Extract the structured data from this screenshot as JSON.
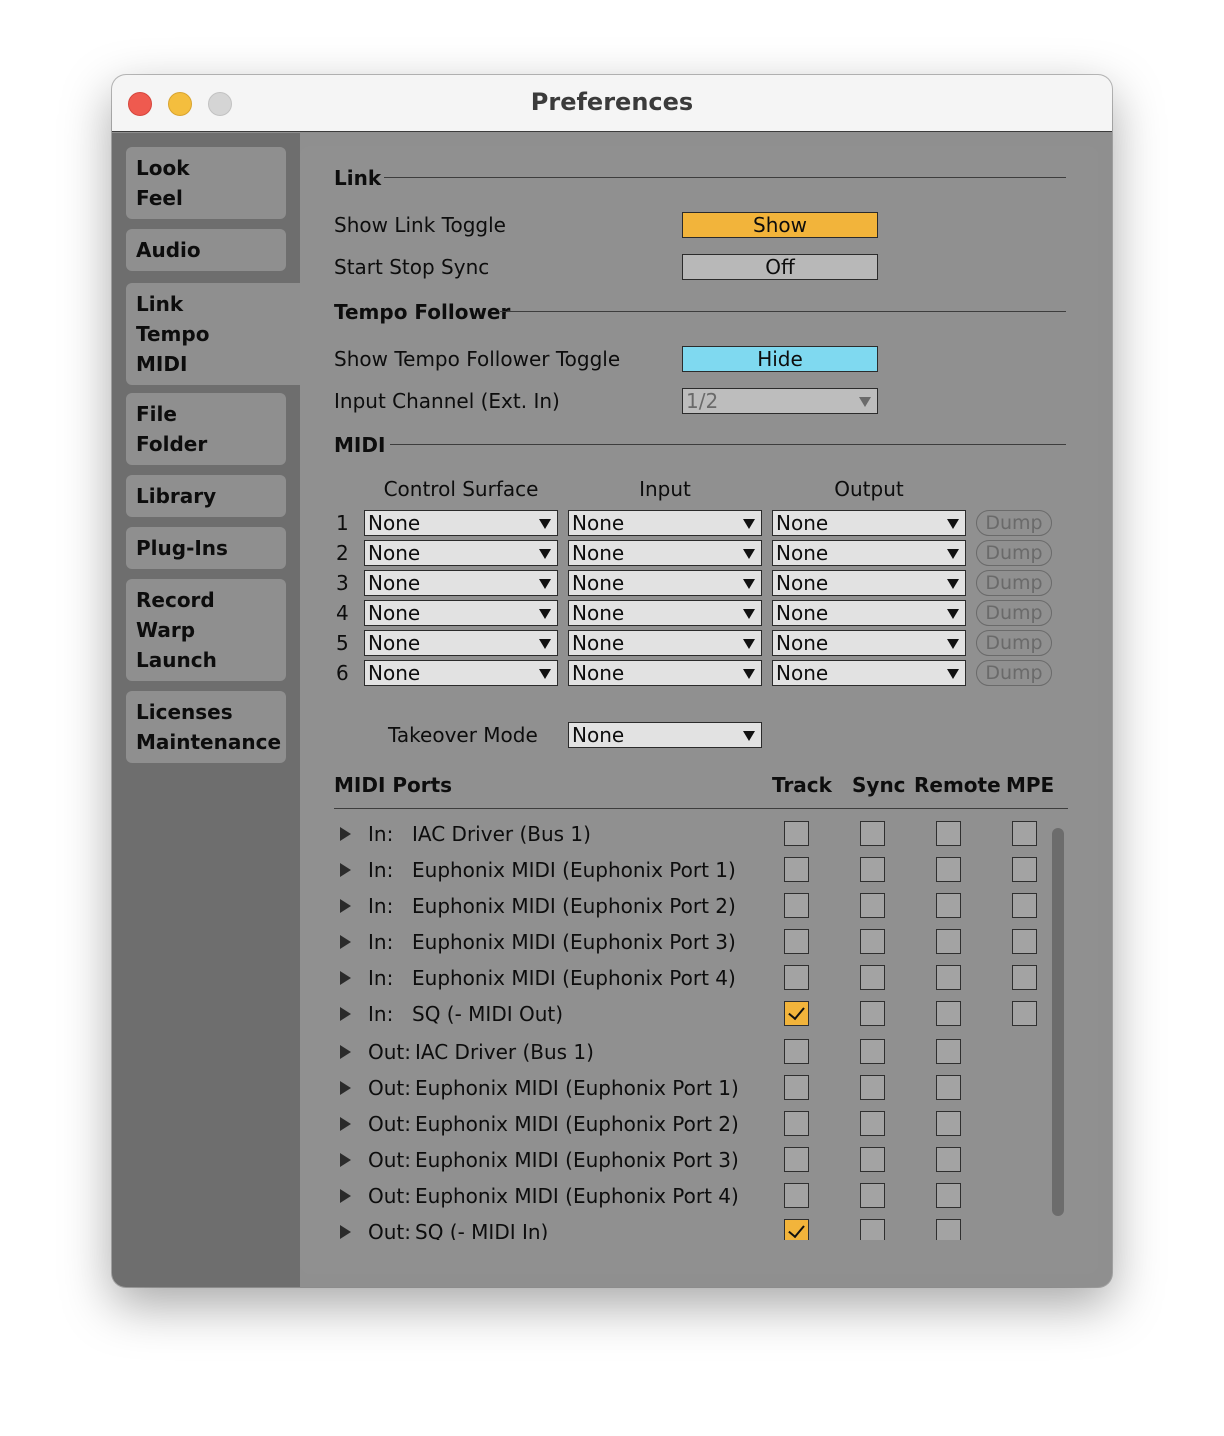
{
  "window": {
    "title": "Preferences"
  },
  "sidebar": {
    "tabs": [
      {
        "lines": [
          "Look",
          "Feel"
        ]
      },
      {
        "lines": [
          "Audio"
        ]
      },
      {
        "lines": [
          "Link",
          "Tempo",
          "MIDI"
        ],
        "active": true
      },
      {
        "lines": [
          "File",
          "Folder"
        ]
      },
      {
        "lines": [
          "Library"
        ]
      },
      {
        "lines": [
          "Plug-Ins"
        ]
      },
      {
        "lines": [
          "Record",
          "Warp",
          "Launch"
        ]
      },
      {
        "lines": [
          "Licenses",
          "Maintenance"
        ]
      }
    ]
  },
  "link": {
    "heading": "Link",
    "show_link_toggle": {
      "label": "Show Link Toggle",
      "value": "Show",
      "color": "#f2b43b"
    },
    "start_stop_sync": {
      "label": "Start Stop Sync",
      "value": "Off",
      "color": "#b8b8b8"
    }
  },
  "tempo_follower": {
    "heading": "Tempo Follower",
    "show_toggle": {
      "label": "Show Tempo Follower Toggle",
      "value": "Hide",
      "color": "#7fd9f0"
    },
    "input_channel": {
      "label": "Input Channel (Ext. In)",
      "value": "1/2"
    }
  },
  "midi": {
    "heading": "MIDI",
    "columns": {
      "control_surface": "Control Surface",
      "input": "Input",
      "output": "Output"
    },
    "rows": [
      {
        "num": "1",
        "control_surface": "None",
        "input": "None",
        "output": "None",
        "dump": "Dump"
      },
      {
        "num": "2",
        "control_surface": "None",
        "input": "None",
        "output": "None",
        "dump": "Dump"
      },
      {
        "num": "3",
        "control_surface": "None",
        "input": "None",
        "output": "None",
        "dump": "Dump"
      },
      {
        "num": "4",
        "control_surface": "None",
        "input": "None",
        "output": "None",
        "dump": "Dump"
      },
      {
        "num": "5",
        "control_surface": "None",
        "input": "None",
        "output": "None",
        "dump": "Dump"
      },
      {
        "num": "6",
        "control_surface": "None",
        "input": "None",
        "output": "None",
        "dump": "Dump"
      }
    ],
    "takeover_mode": {
      "label": "Takeover Mode",
      "value": "None"
    }
  },
  "midi_ports": {
    "heading": "MIDI Ports",
    "columns": {
      "track": "Track",
      "sync": "Sync",
      "remote": "Remote",
      "mpe": "MPE"
    },
    "ports": [
      {
        "dir": "In:",
        "name": "IAC Driver (Bus 1)",
        "track": false,
        "sync": false,
        "remote": false,
        "mpe": false
      },
      {
        "dir": "In:",
        "name": "Euphonix MIDI (Euphonix Port 1)",
        "track": false,
        "sync": false,
        "remote": false,
        "mpe": false
      },
      {
        "dir": "In:",
        "name": "Euphonix MIDI (Euphonix Port 2)",
        "track": false,
        "sync": false,
        "remote": false,
        "mpe": false
      },
      {
        "dir": "In:",
        "name": "Euphonix MIDI (Euphonix Port 3)",
        "track": false,
        "sync": false,
        "remote": false,
        "mpe": false
      },
      {
        "dir": "In:",
        "name": "Euphonix MIDI (Euphonix Port 4)",
        "track": false,
        "sync": false,
        "remote": false,
        "mpe": false
      },
      {
        "dir": "In:",
        "name": "SQ (- MIDI Out)",
        "track": true,
        "sync": false,
        "remote": false,
        "mpe": false
      },
      {
        "dir": "Out:",
        "name": "IAC Driver (Bus 1)",
        "track": false,
        "sync": false,
        "remote": false
      },
      {
        "dir": "Out:",
        "name": "Euphonix MIDI (Euphonix Port 1)",
        "track": false,
        "sync": false,
        "remote": false
      },
      {
        "dir": "Out:",
        "name": "Euphonix MIDI (Euphonix Port 2)",
        "track": false,
        "sync": false,
        "remote": false
      },
      {
        "dir": "Out:",
        "name": "Euphonix MIDI (Euphonix Port 3)",
        "track": false,
        "sync": false,
        "remote": false
      },
      {
        "dir": "Out:",
        "name": "Euphonix MIDI (Euphonix Port 4)",
        "track": false,
        "sync": false,
        "remote": false
      },
      {
        "dir": "Out:",
        "name": "SQ (- MIDI In)",
        "track": true,
        "sync": false,
        "remote": false
      }
    ]
  }
}
